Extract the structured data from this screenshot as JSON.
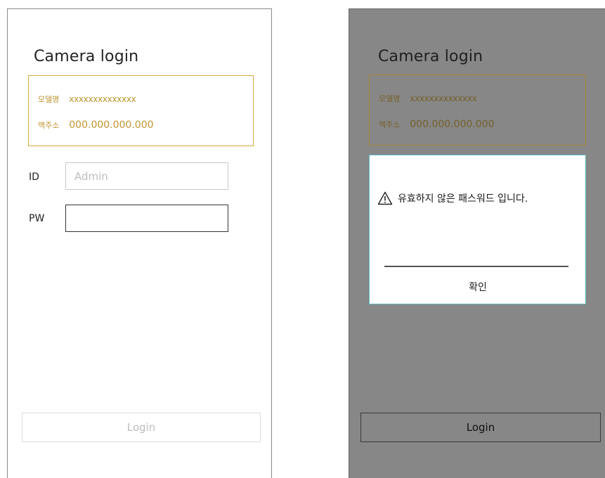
{
  "left_screen": {
    "title": "Camera login",
    "info": {
      "model_label": "모델명",
      "model_value": "xxxxxxxxxxxxxx",
      "mac_label": "맥주소",
      "mac_value": "000.000.000.000"
    },
    "id_label": "ID",
    "id_placeholder": "Admin",
    "pw_label": "PW",
    "login_label": "Login"
  },
  "right_screen": {
    "title": "Camera login",
    "info": {
      "model_label": "모델명",
      "model_value": "xxxxxxxxxxxxxx",
      "mac_label": "맥주소",
      "mac_value": "000.000.000.000"
    },
    "dialog": {
      "icon": "warning-icon",
      "message": "유효하지 않은 패스워드 입니다.",
      "confirm_label": "확인"
    },
    "login_label": "Login"
  },
  "colors": {
    "accent_gold": "#d4a937",
    "overlay_gray": "#878787",
    "dialog_border": "#5fb9c4"
  }
}
